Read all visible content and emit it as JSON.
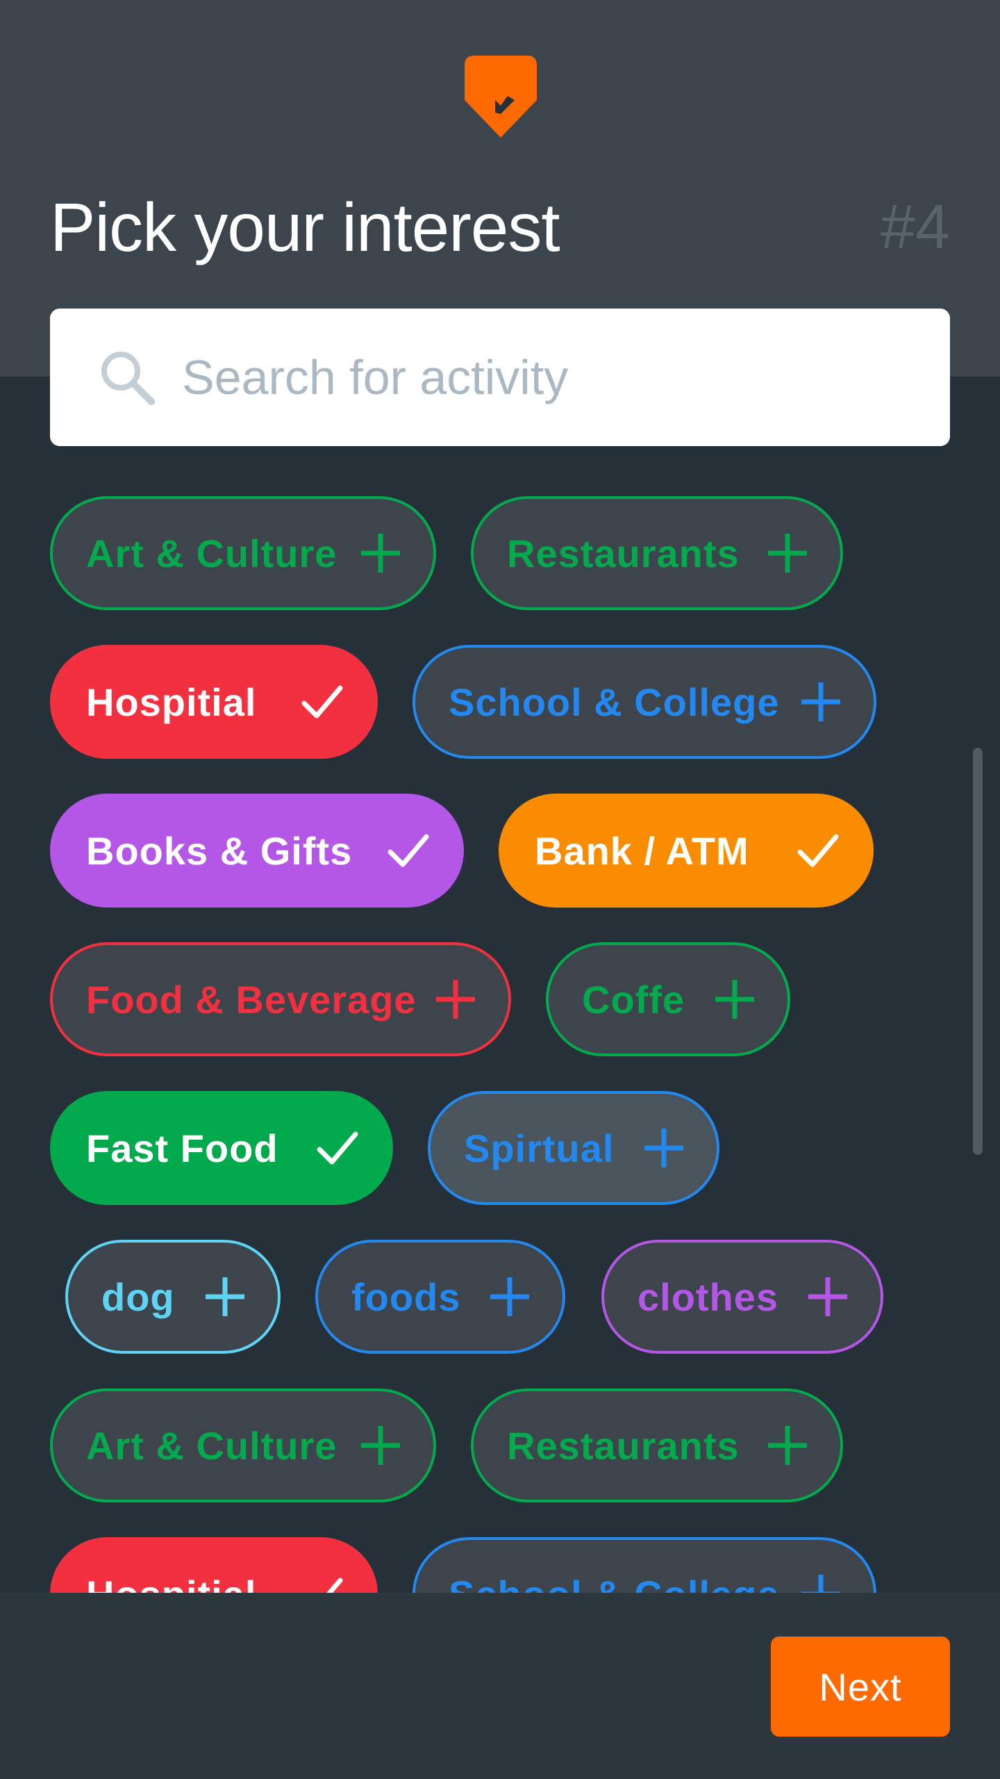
{
  "header": {
    "title": "Pick your interest",
    "step": "#4",
    "logo_color": "#ff6a00"
  },
  "search": {
    "placeholder": "Search for activity",
    "icon": "search-icon"
  },
  "colors": {
    "green": "#03aa4d",
    "blue": "#2389f0",
    "red": "#f2303f",
    "purple": "#b457e6",
    "orange": "#f98c00",
    "cyan": "#5ed3f3",
    "unselected_bg": "#3d444b"
  },
  "chips": [
    {
      "label": "Art & Culture",
      "color": "#03aa4d",
      "selected": false
    },
    {
      "label": "Restaurants",
      "color": "#03aa4d",
      "selected": false
    },
    {
      "label": "Hospitial",
      "color": "#f2303f",
      "selected": true
    },
    {
      "label": "School & College",
      "color": "#2389f0",
      "selected": false
    },
    {
      "label": "Books & Gifts",
      "color": "#b457e6",
      "selected": true
    },
    {
      "label": "Bank / ATM",
      "color": "#f98c00",
      "selected": true
    },
    {
      "label": "Food & Beverage",
      "color": "#f2303f",
      "selected": false
    },
    {
      "label": "Coffe",
      "color": "#03aa4d",
      "selected": false
    },
    {
      "label": "Fast Food",
      "color": "#03aa4d",
      "selected": true
    },
    {
      "label": "Spirtual",
      "color": "#2389f0",
      "selected": false
    },
    {
      "label": "dog",
      "color": "#5ed3f3",
      "selected": false
    },
    {
      "label": "foods",
      "color": "#2389f0",
      "selected": false
    },
    {
      "label": "clothes",
      "color": "#b457e6",
      "selected": false
    },
    {
      "label": "Art & Culture",
      "color": "#03aa4d",
      "selected": false
    },
    {
      "label": "Restaurants",
      "color": "#03aa4d",
      "selected": false
    },
    {
      "label": "Hospitial",
      "color": "#f2303f",
      "selected": true
    },
    {
      "label": "School & College",
      "color": "#2389f0",
      "selected": false
    }
  ],
  "footer": {
    "next_label": "Next"
  }
}
